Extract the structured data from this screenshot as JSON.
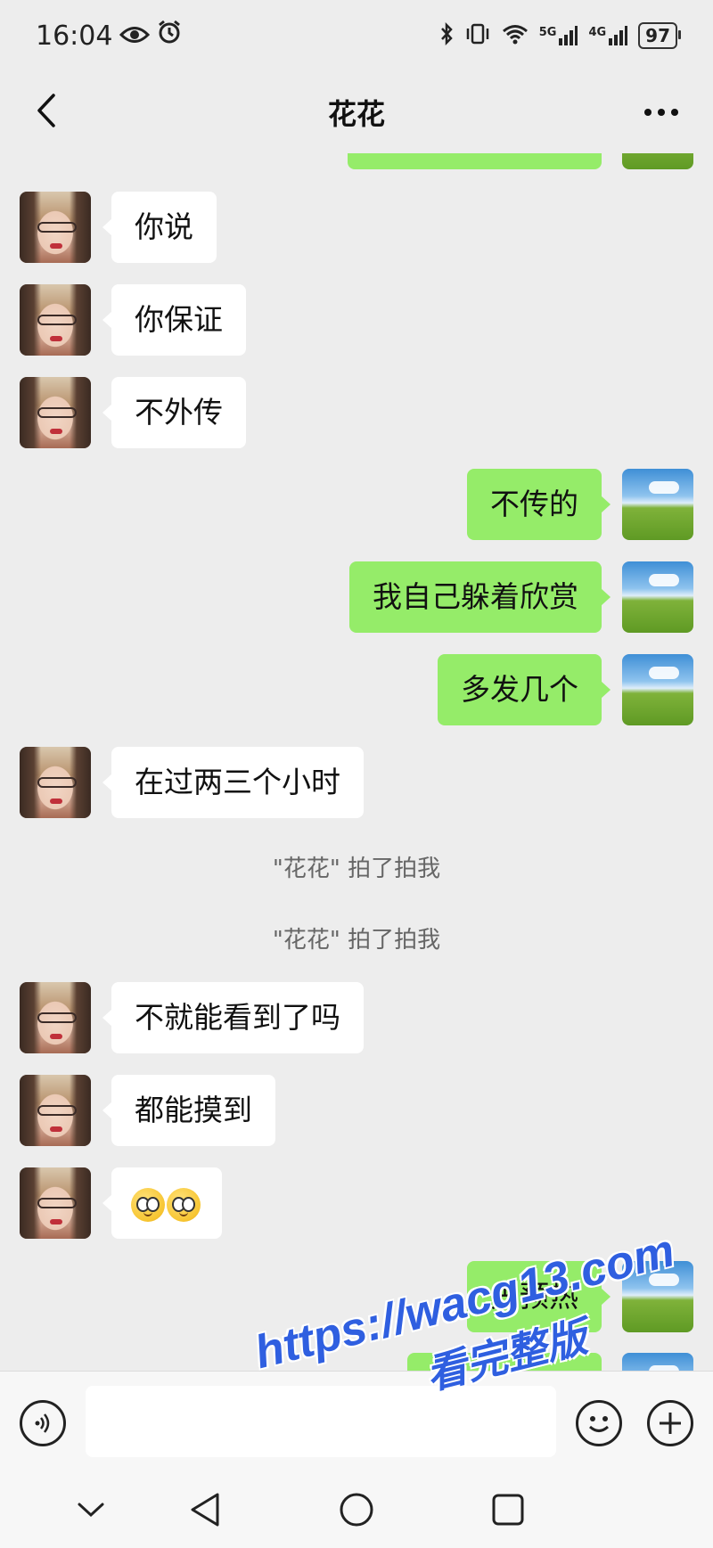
{
  "status_bar": {
    "time": "16:04",
    "network_5g": "5G",
    "network_4g": "4G",
    "battery": "97"
  },
  "header": {
    "title": "花花"
  },
  "messages": [
    {
      "from": "her",
      "text": "你说"
    },
    {
      "from": "her",
      "text": "你保证"
    },
    {
      "from": "her",
      "text": "不外传"
    },
    {
      "from": "me",
      "text": "不传的"
    },
    {
      "from": "me",
      "text": "我自己躲着欣赏"
    },
    {
      "from": "me",
      "text": "多发几个"
    },
    {
      "from": "her",
      "text": "在过两三个小时"
    },
    {
      "from": "system",
      "text": "\"花花\" 拍了拍我"
    },
    {
      "from": "system",
      "text": "\"花花\" 拍了拍我"
    },
    {
      "from": "her",
      "text": "不就能看到了吗"
    },
    {
      "from": "her",
      "text": "都能摸到"
    },
    {
      "from": "her",
      "emoji": "astonished-face x2"
    },
    {
      "from": "me",
      "text": "先预热"
    }
  ],
  "input_bar": {
    "value": "",
    "icons": [
      "voice-icon",
      "emoji-icon",
      "plus-icon"
    ]
  },
  "nav_bar": {
    "icons": [
      "chevron-down-icon",
      "back-triangle-icon",
      "home-circle-icon",
      "recents-square-icon"
    ]
  },
  "watermark": {
    "url": "https://wacg13.com",
    "sub": "看完整版"
  },
  "colors": {
    "background": "#ededed",
    "my_bubble": "#95ec69",
    "her_bubble": "#ffffff",
    "watermark": "#2f5fe0"
  }
}
